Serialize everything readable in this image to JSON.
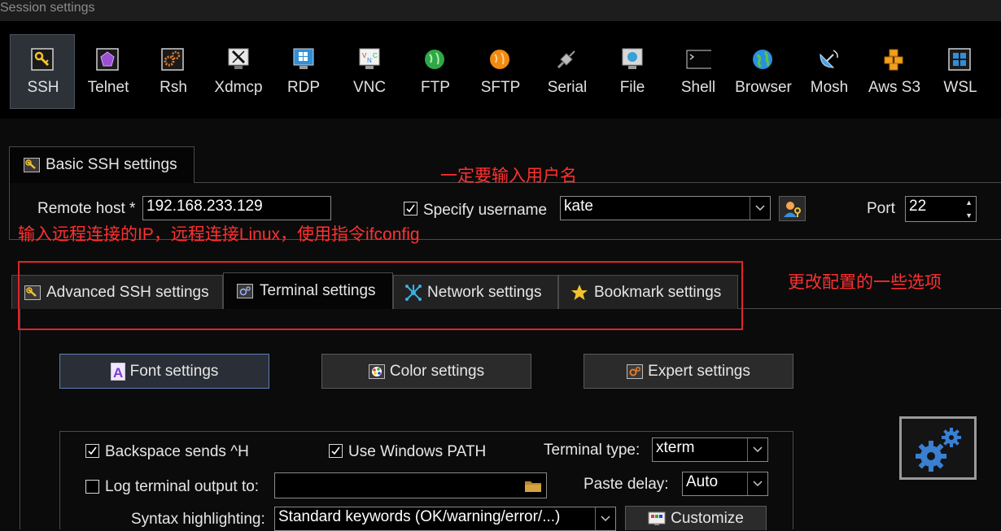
{
  "window": {
    "title": "Session settings"
  },
  "session_types": [
    {
      "label": "SSH",
      "icon": "key-icon",
      "selected": true
    },
    {
      "label": "Telnet",
      "icon": "purple-gem-icon"
    },
    {
      "label": "Rsh",
      "icon": "gears-icon"
    },
    {
      "label": "Xdmcp",
      "icon": "x-monitor-icon"
    },
    {
      "label": "RDP",
      "icon": "windows-monitor-icon"
    },
    {
      "label": "VNC",
      "icon": "vnc-monitor-icon"
    },
    {
      "label": "FTP",
      "icon": "green-globe-icon"
    },
    {
      "label": "SFTP",
      "icon": "orange-globe-icon"
    },
    {
      "label": "Serial",
      "icon": "satellite-plug-icon"
    },
    {
      "label": "File",
      "icon": "file-monitor-icon"
    },
    {
      "label": "Shell",
      "icon": "shell-prompt-icon"
    },
    {
      "label": "Browser",
      "icon": "browser-globe-icon"
    },
    {
      "label": "Mosh",
      "icon": "satellite-dish-icon"
    },
    {
      "label": "Aws S3",
      "icon": "aws-cubes-icon"
    },
    {
      "label": "WSL",
      "icon": "windows-logo-icon"
    }
  ],
  "basic": {
    "tab_label": "Basic SSH settings",
    "remote_host_label": "Remote host *",
    "remote_host_value": "192.168.233.129",
    "specify_username_label": "Specify username",
    "specify_username_checked": true,
    "username_value": "kate",
    "port_label": "Port",
    "port_value": "22"
  },
  "annotations": {
    "username": "一定要输入用户名",
    "remote_ip": "输入远程连接的IP，远程连接Linux，使用指令ifconfig",
    "tabs": "更改配置的一些选项"
  },
  "tabs": [
    {
      "label": "Advanced SSH settings",
      "icon": "wrench-icon"
    },
    {
      "label": "Terminal settings",
      "icon": "terminal-gears-icon",
      "active": true
    },
    {
      "label": "Network settings",
      "icon": "network-star-icon"
    },
    {
      "label": "Bookmark settings",
      "icon": "star-icon"
    }
  ],
  "terminal": {
    "font_button": "Font settings",
    "color_button": "Color settings",
    "expert_button": "Expert settings",
    "backspace_label": "Backspace sends ^H",
    "backspace_checked": true,
    "windows_path_label": "Use Windows PATH",
    "windows_path_checked": true,
    "terminal_type_label": "Terminal type:",
    "terminal_type_value": "xterm",
    "log_output_label": "Log terminal output to:",
    "log_output_checked": false,
    "log_output_value": "",
    "paste_delay_label": "Paste delay:",
    "paste_delay_value": "Auto",
    "syntax_label": "Syntax highlighting:",
    "syntax_value": "Standard keywords (OK/warning/error/...)",
    "customize_button": "Customize"
  },
  "colors": {
    "annotation": "#e0242c",
    "accent": "#5d7fb4",
    "background": "#0b0b0b"
  }
}
